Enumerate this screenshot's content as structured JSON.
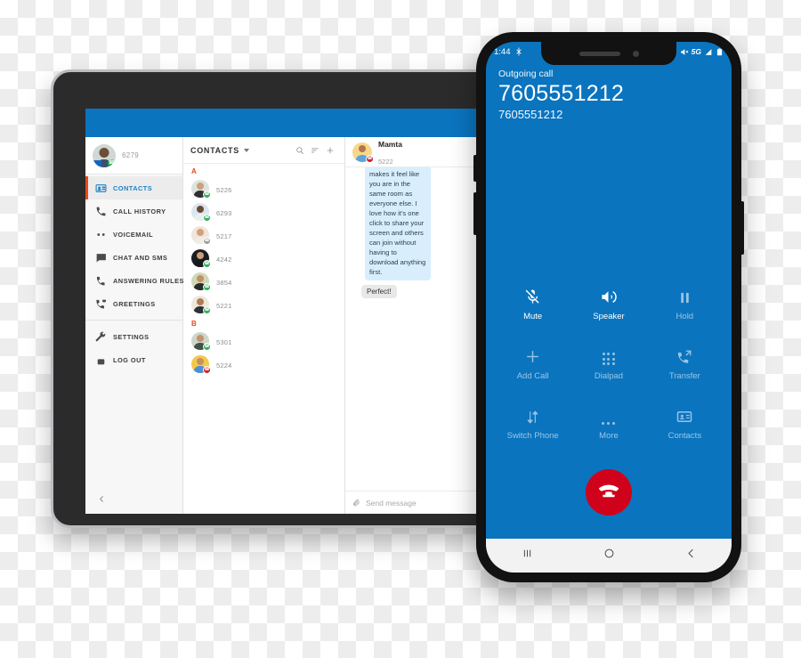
{
  "tablet": {
    "app_header_color": "#0a74bf",
    "user": {
      "extension": "6279",
      "avatar_icon": "user-avatar"
    },
    "sidebar": {
      "collapse_icon": "chevron-left-icon",
      "items": [
        {
          "label": "CONTACTS",
          "icon": "contacts-icon",
          "active": true
        },
        {
          "label": "CALL HISTORY",
          "icon": "call-history-icon",
          "active": false
        },
        {
          "label": "VOICEMAIL",
          "icon": "voicemail-icon",
          "active": false
        },
        {
          "label": "CHAT AND SMS",
          "icon": "chat-icon",
          "active": false
        },
        {
          "label": "ANSWERING RULES",
          "icon": "answering-rules-icon",
          "active": false
        },
        {
          "label": "GREETINGS",
          "icon": "greetings-icon",
          "active": false
        }
      ],
      "footer_items": [
        {
          "label": "SETTINGS",
          "icon": "wrench-icon"
        },
        {
          "label": "LOG OUT",
          "icon": "lock-icon"
        }
      ],
      "active_indicator_color": "#e8491d",
      "active_text_color": "#1d7fc4"
    },
    "contacts": {
      "title": "CONTACTS",
      "dropdown_icon": "chevron-down-icon",
      "actions": [
        {
          "icon": "search-icon",
          "name": "search"
        },
        {
          "icon": "sort-icon",
          "name": "sort"
        },
        {
          "icon": "plus-icon",
          "name": "add-contact"
        }
      ],
      "groups": [
        {
          "letter": "A",
          "rows": [
            {
              "extension": "5226",
              "status": "available",
              "status_icon": "phone-icon",
              "skin": "#caa07e",
              "shirt": "#2f2f33",
              "bg": "#dfe3df"
            },
            {
              "extension": "6293",
              "status": "available",
              "status_icon": "phone-icon",
              "skin": "#6b4a33",
              "shirt": "#e9eef2",
              "bg": "#dbe6ef"
            },
            {
              "extension": "5217",
              "status": "away",
              "status_icon": "phone-icon",
              "skin": "#d0a17c",
              "shirt": "#f0ece6",
              "bg": "#f2e4d8"
            },
            {
              "extension": "4242",
              "status": "available",
              "status_icon": "phone-icon",
              "skin": "#c9a07c",
              "shirt": "#16181c",
              "bg": "#1b1d21"
            },
            {
              "extension": "3854",
              "status": "available",
              "status_icon": "phone-icon",
              "skin": "#c58f6a",
              "shirt": "#2a2a2a",
              "bg": "#cfd9b5"
            },
            {
              "extension": "5221",
              "status": "available",
              "status_icon": "phone-icon",
              "skin": "#b07c52",
              "shirt": "#2b2f38",
              "bg": "#efe7dd"
            }
          ]
        },
        {
          "letter": "B",
          "rows": [
            {
              "extension": "5301",
              "status": "available",
              "status_icon": "phone-icon",
              "skin": "#c39371",
              "shirt": "#44504a",
              "bg": "#cdd6c8"
            },
            {
              "extension": "5224",
              "status": "busy",
              "status_icon": "phone-icon",
              "skin": "#c98f63",
              "shirt": "#4a90d9",
              "bg": "#f2c94c"
            }
          ]
        }
      ]
    },
    "chat": {
      "contact_name": "Mamta",
      "contact_extension": "5222",
      "contact_status": "busy",
      "incoming_message": "makes it feel like you are in the same room as everyone else. I love how it's one click to share your screen and others can join without having to download anything first.",
      "outgoing_message": "Perfect!",
      "attach_icon": "paperclip-icon",
      "input_placeholder": "Send message"
    }
  },
  "phone": {
    "screen_color": "#0a74bf",
    "statusbar": {
      "time": "1:44",
      "left_icon": "bluetooth-icon",
      "right_icons": [
        "mute-signal-icon",
        "5G",
        "signal-bars-icon",
        "battery-icon"
      ],
      "network": "5G"
    },
    "call": {
      "state": "Outgoing call",
      "display_name": "7605551212",
      "number": "7605551212"
    },
    "controls": [
      {
        "label": "Mute",
        "icon": "mic-off-icon",
        "dim": false
      },
      {
        "label": "Speaker",
        "icon": "speaker-icon",
        "dim": false
      },
      {
        "label": "Hold",
        "icon": "pause-icon",
        "dim": true
      },
      {
        "label": "Add Call",
        "icon": "plus-icon",
        "dim": true
      },
      {
        "label": "Dialpad",
        "icon": "dialpad-icon",
        "dim": true
      },
      {
        "label": "Transfer",
        "icon": "call-transfer-icon",
        "dim": true
      },
      {
        "label": "Switch Phone",
        "icon": "swap-icon",
        "dim": true
      },
      {
        "label": "More",
        "icon": "more-icon",
        "dim": true
      },
      {
        "label": "Contacts",
        "icon": "contact-card-icon",
        "dim": true
      }
    ],
    "end_call": {
      "icon": "end-call-icon",
      "color": "#d0021b"
    },
    "navbar": [
      {
        "icon": "recents-icon"
      },
      {
        "icon": "home-icon"
      },
      {
        "icon": "back-icon"
      }
    ]
  }
}
